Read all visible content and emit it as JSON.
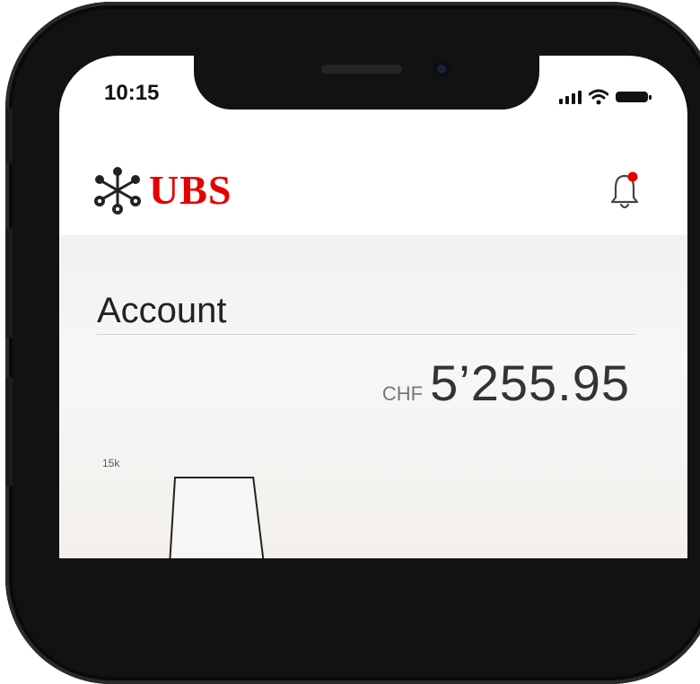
{
  "status_bar": {
    "time": "10:15",
    "icons": [
      "signal-icon",
      "wifi-icon",
      "battery-icon"
    ]
  },
  "header": {
    "logo_text": "UBS",
    "logo_icon": "ubs-keys-icon",
    "notification_icon": "bell-icon",
    "notification_badge": true,
    "brand_color": "#e60000"
  },
  "account": {
    "title": "Account",
    "currency": "CHF",
    "balance": "5’255.95"
  },
  "chart_data": {
    "type": "area",
    "y_tick_labels": [
      "15k"
    ],
    "visible_area": {
      "x_start_fraction": 0.15,
      "x_end_fraction": 0.31
    },
    "fill_color": "#f6f6f6",
    "stroke_color": "#222222"
  }
}
